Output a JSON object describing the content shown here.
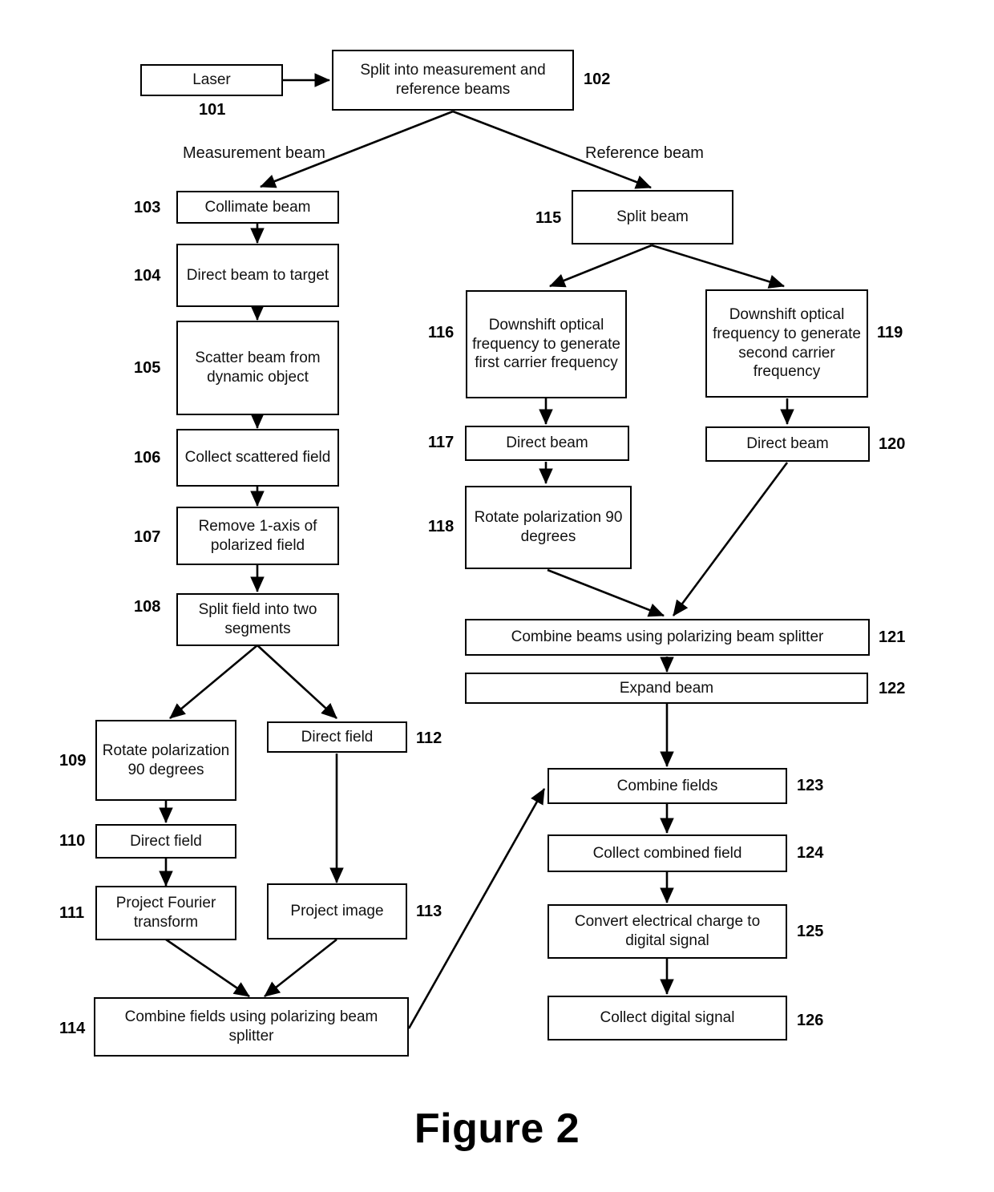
{
  "figure": {
    "caption": "Figure 2"
  },
  "edge_labels": {
    "measurement_beam": "Measurement beam",
    "reference_beam": "Reference beam"
  },
  "nodes": [
    {
      "ref": "101",
      "label": "Laser"
    },
    {
      "ref": "102",
      "label": "Split into measurement and reference beams"
    },
    {
      "ref": "103",
      "label": "Collimate beam"
    },
    {
      "ref": "104",
      "label": "Direct beam to target"
    },
    {
      "ref": "105",
      "label": "Scatter beam from dynamic object"
    },
    {
      "ref": "106",
      "label": "Collect scattered field"
    },
    {
      "ref": "107",
      "label": "Remove 1-axis of polarized field"
    },
    {
      "ref": "108",
      "label": "Split field into two segments"
    },
    {
      "ref": "109",
      "label": "Rotate polarization 90 degrees"
    },
    {
      "ref": "110",
      "label": "Direct field"
    },
    {
      "ref": "111",
      "label": "Project Fourier transform"
    },
    {
      "ref": "112",
      "label": "Direct field"
    },
    {
      "ref": "113",
      "label": "Project image"
    },
    {
      "ref": "114",
      "label": "Combine fields using polarizing beam splitter"
    },
    {
      "ref": "115",
      "label": "Split beam"
    },
    {
      "ref": "116",
      "label": "Downshift optical frequency to generate first carrier frequency"
    },
    {
      "ref": "117",
      "label": "Direct beam"
    },
    {
      "ref": "118",
      "label": "Rotate polarization 90 degrees"
    },
    {
      "ref": "119",
      "label": "Downshift optical frequency to generate second carrier frequency"
    },
    {
      "ref": "120",
      "label": "Direct beam"
    },
    {
      "ref": "121",
      "label": "Combine beams using polarizing beam splitter"
    },
    {
      "ref": "122",
      "label": "Expand beam"
    },
    {
      "ref": "123",
      "label": "Combine fields"
    },
    {
      "ref": "124",
      "label": "Collect combined field"
    },
    {
      "ref": "125",
      "label": "Convert electrical charge to digital signal"
    },
    {
      "ref": "126",
      "label": "Collect digital signal"
    }
  ]
}
